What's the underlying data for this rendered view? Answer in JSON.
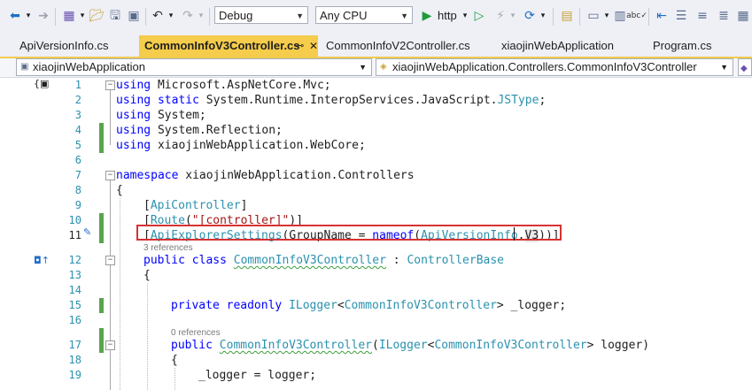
{
  "toolbar": {
    "configuration": "Debug",
    "platform": "Any CPU",
    "run_target": "http"
  },
  "tabs": [
    {
      "label": "ApiVersionInfo.cs"
    },
    {
      "label": "CommonInfoV3Controller.cs",
      "active": true
    },
    {
      "label": "CommonInfoV2Controller.cs"
    },
    {
      "label": "xiaojinWebApplication"
    },
    {
      "label": "Program.cs"
    }
  ],
  "navbar": {
    "project": "xiaojinWebApplication",
    "type": "xiaojinWebApplication.Controllers.CommonInfoV3Controller"
  },
  "editor": {
    "line_numbers": [
      "1",
      "2",
      "3",
      "4",
      "5",
      "6",
      "7",
      "8",
      "9",
      "10",
      "11",
      "12",
      "13",
      "14",
      "15",
      "16",
      "17",
      "18",
      "19"
    ],
    "references_3": "3 references",
    "references_0": "0 references",
    "lines": {
      "l1": {
        "a": "using",
        "b": " Microsoft.AspNetCore.Mvc;"
      },
      "l2": {
        "a": "using",
        "b": " static",
        "c": " System.Runtime.InteropServices.JavaScript.",
        "d": "JSType",
        "e": ";"
      },
      "l3": {
        "a": "using",
        "b": " System;"
      },
      "l4": {
        "a": "using",
        "b": " System.Reflection;"
      },
      "l5": {
        "a": "using",
        "b": " xiaojinWebApplication.WebCore;"
      },
      "l7": {
        "a": "namespace",
        "b": " xiaojinWebApplication.Controllers"
      },
      "l8": {
        "a": "{"
      },
      "l9": {
        "a": "[",
        "b": "ApiController",
        "c": "]"
      },
      "l10": {
        "a": "[",
        "b": "Route",
        "c": "(",
        "d": "\"[controller]\"",
        "e": ")]"
      },
      "l11": {
        "a": "[",
        "b": "ApiExplorerSettings",
        "c": "(GroupName = ",
        "d": "nameof",
        "e": "(",
        "f": "ApiVersionInfo",
        "g": ".",
        "h": "V3",
        "i": "))]"
      },
      "l12": {
        "a": "public",
        "b": " class",
        "c": " ",
        "d": "CommonInfoV3Controller",
        "e": " : ",
        "f": "ControllerBase"
      },
      "l13": {
        "a": "{"
      },
      "l15": {
        "a": "private",
        "b": " readonly",
        "c": " ",
        "d": "ILogger",
        "e": "<",
        "f": "CommonInfoV3Controller",
        "g": "> _logger;"
      },
      "l17": {
        "a": "public",
        "b": " ",
        "c": "CommonInfoV3Controller",
        "d": "(",
        "e": "ILogger",
        "f": "<",
        "g": "CommonInfoV3Controller",
        "h": "> logger)"
      },
      "l18": {
        "a": "{"
      },
      "l19": {
        "a": "_logger = logger;"
      }
    }
  }
}
